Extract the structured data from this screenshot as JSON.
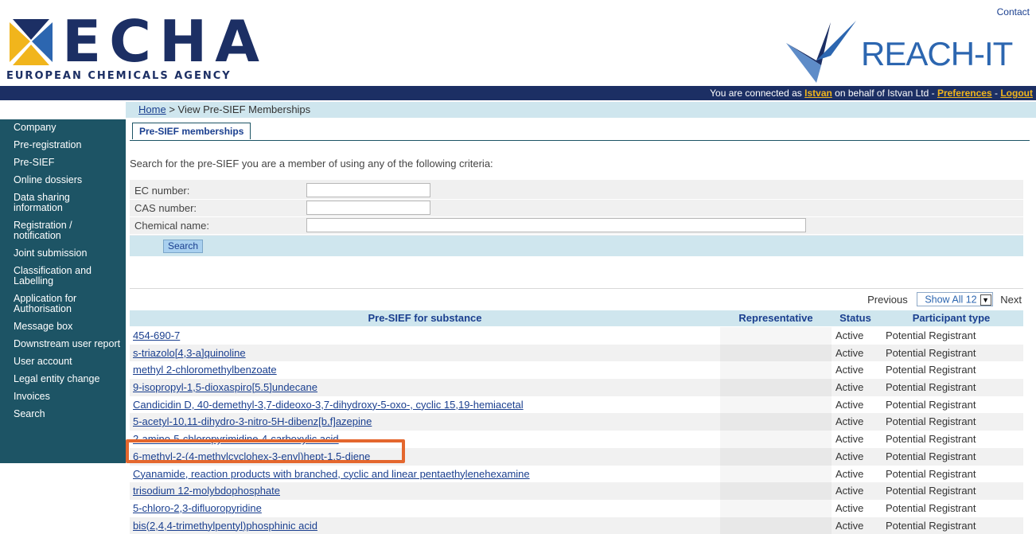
{
  "header": {
    "contact": "Contact",
    "echa_word": "ECHA",
    "echa_subtitle": "EUROPEAN CHEMICALS AGENCY",
    "reach_word": "REACH-IT",
    "connection_prefix": "You are connected as",
    "user": "Istvan",
    "connection_middle": "on behalf of Istvan Ltd -",
    "preferences": "Preferences",
    "separator": "-",
    "logout": "Logout"
  },
  "breadcrumb": {
    "home": "Home",
    "current": "> View Pre-SIEF Memberships"
  },
  "sidebar": {
    "items": [
      {
        "label": "Company"
      },
      {
        "label": "Pre-registration"
      },
      {
        "label": "Pre-SIEF"
      },
      {
        "label": "Online dossiers"
      },
      {
        "label": "Data sharing information"
      },
      {
        "label": "Registration / notification"
      },
      {
        "label": "Joint submission"
      },
      {
        "label": "Classification and Labelling"
      },
      {
        "label": "Application for Authorisation"
      },
      {
        "label": "Message box"
      },
      {
        "label": "Downstream user report"
      },
      {
        "label": "User account"
      },
      {
        "label": "Legal entity change"
      },
      {
        "label": "Invoices"
      },
      {
        "label": "Search"
      }
    ]
  },
  "tab": {
    "label": "Pre-SIEF memberships"
  },
  "search": {
    "intro": "Search for the pre-SIEF you are a member of using any of the following criteria:",
    "ec_label": "EC number:",
    "cas_label": "CAS number:",
    "name_label": "Chemical name:",
    "ec_value": "",
    "cas_value": "",
    "name_value": "",
    "button": "Search"
  },
  "pager": {
    "previous": "Previous",
    "show": "Show All 12",
    "next": "Next"
  },
  "table": {
    "headers": {
      "substance": "Pre-SIEF for substance",
      "representative": "Representative",
      "status": "Status",
      "participant": "Participant type"
    },
    "rows": [
      {
        "substance": "454-690-7",
        "status": "Active",
        "participant": "Potential Registrant"
      },
      {
        "substance": "s-triazolo[4,3-a]quinoline",
        "status": "Active",
        "participant": "Potential Registrant"
      },
      {
        "substance": "methyl 2-chloromethylbenzoate",
        "status": "Active",
        "participant": "Potential Registrant"
      },
      {
        "substance": "9-isopropyl-1,5-dioxaspiro[5.5]undecane",
        "status": "Active",
        "participant": "Potential Registrant"
      },
      {
        "substance": "Candicidin D, 40-demethyl-3,7-dideoxo-3,7-dihydroxy-5-oxo-, cyclic 15,19-hemiacetal",
        "status": "Active",
        "participant": "Potential Registrant"
      },
      {
        "substance": "5-acetyl-10,11-dihydro-3-nitro-5H-dibenz[b,f]azepine",
        "status": "Active",
        "participant": "Potential Registrant"
      },
      {
        "substance": "2-amino-5-chloropyrimidine-4-carboxylic acid",
        "status": "Active",
        "participant": "Potential Registrant"
      },
      {
        "substance": "6-methyl-2-(4-methylcyclohex-3-enyl)hept-1,5-diene",
        "status": "Active",
        "participant": "Potential Registrant"
      },
      {
        "substance": "Cyanamide, reaction products with branched, cyclic and linear pentaethylenehexamine",
        "status": "Active",
        "participant": "Potential Registrant"
      },
      {
        "substance": "trisodium 12-molybdophosphate",
        "status": "Active",
        "participant": "Potential Registrant"
      },
      {
        "substance": "5-chloro-2,3-difluoropyridine",
        "status": "Active",
        "participant": "Potential Registrant"
      },
      {
        "substance": "bis(2,4,4-trimethylpentyl)phosphinic acid",
        "status": "Active",
        "participant": "Potential Registrant"
      }
    ]
  },
  "colors": {
    "navy": "#1c2f64",
    "sidebar": "#1d5465",
    "light_blue": "#cfe6ee",
    "highlight": "#e4672e",
    "link_gold": "#f1b51c"
  }
}
